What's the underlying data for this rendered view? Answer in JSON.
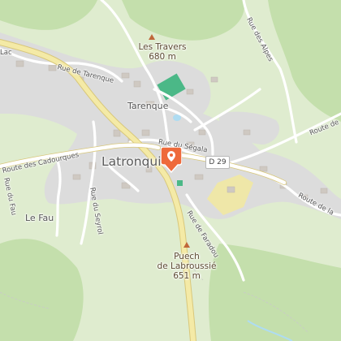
{
  "map": {
    "place_labels": {
      "les_travers": "Les Travers",
      "les_travers_elev": "680 m",
      "tarenque": "Tarenque",
      "latronquiere": "Latronquiè",
      "le_fau": "Le Fau",
      "puech": "Puech",
      "puech_name": "de Labroussié",
      "puech_elev": "651 m"
    },
    "road_labels": {
      "rue_de_tarenque": "Rue de Tarenque",
      "rue_du_segala": "Rue du Ségala",
      "route_des_cadourques": "Route des Cadourques",
      "rue_du_fau": "Rue du Fau",
      "rue_du_seyrol": "Rue du Seyrol",
      "rue_de_faradou": "Rue de Faradou",
      "route_de_la": "Route de la",
      "route_de_top": "Route de",
      "rue_des_alpes": "Rue des Alpes",
      "lac": "Lac"
    },
    "shield": "D 29",
    "colors": {
      "land": "#dfeccf",
      "forest": "#bfdda6",
      "urban": "#dcdcdc",
      "road": "#ffffff",
      "main_road": "#f4eaa6",
      "main_road_casing": "#d8c77a",
      "marker": "#ee6a3b",
      "peak": "#c0673a",
      "sport": "#4bb887",
      "water": "#aedcf2"
    }
  }
}
